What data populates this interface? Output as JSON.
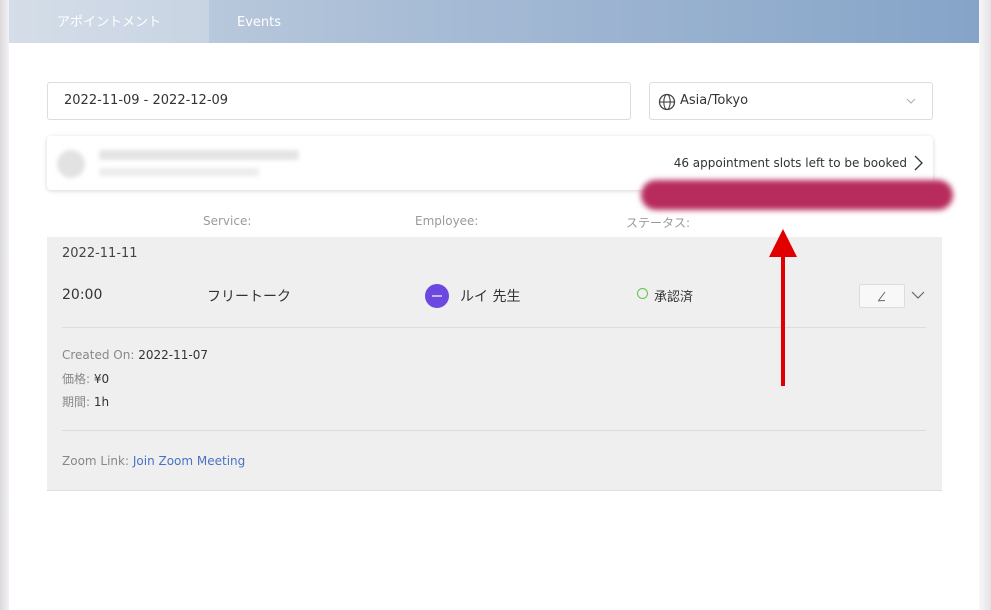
{
  "tabs": [
    {
      "label": "アポイントメント",
      "active": true
    },
    {
      "label": "Events",
      "active": false
    }
  ],
  "filters": {
    "date_range": "2022-11-09 - 2022-12-09",
    "timezone": "Asia/Tokyo"
  },
  "slots_card": {
    "slots_text": "46 appointment slots left to be booked"
  },
  "columns": {
    "service": "Service:",
    "employee": "Employee:",
    "status": "ステータス:"
  },
  "appointment": {
    "date": "2022-11-11",
    "time": "20:00",
    "service": "フリートーク",
    "employee": "ルイ 先生",
    "status": "承認済",
    "created_on_label": "Created On:",
    "created_on_value": "2022-11-07",
    "price_label": "価格:",
    "price_value": "¥0",
    "duration_label": "期間:",
    "duration_value": "1h",
    "zoom_label": "Zoom Link:",
    "zoom_link_text": "Join Zoom Meeting"
  },
  "colors": {
    "status_green": "#61c44a",
    "avatar_purple": "#6b49e0",
    "redaction": "#b72b5d",
    "annotation_arrow": "#e00000",
    "link_blue": "#4a72c4"
  }
}
